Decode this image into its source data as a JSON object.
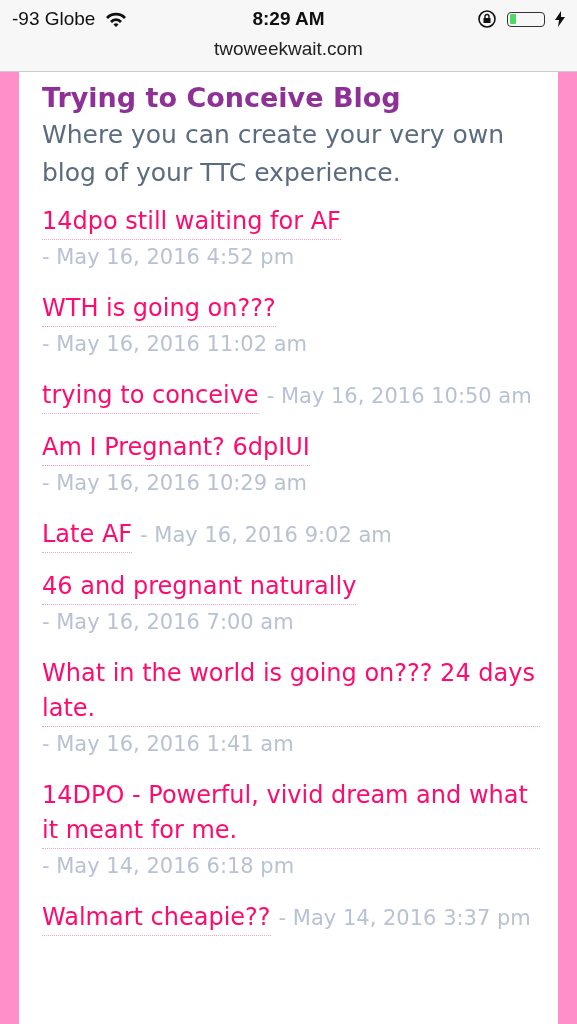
{
  "status_bar": {
    "carrier": "-93 Globe",
    "time": "8:29 AM",
    "charging": true
  },
  "address_bar": {
    "url": "twoweekwait.com"
  },
  "blog": {
    "title": "Trying to Conceive Blog",
    "subtitle": "Where you can create your very own blog of your TTC experience.",
    "posts": [
      {
        "title": "14dpo still waiting for AF",
        "date": "- May 16, 2016 4:52 pm"
      },
      {
        "title": "WTH is going on???",
        "date": "- May 16, 2016 11:02 am"
      },
      {
        "title": "trying to conceive",
        "date": "- May 16, 2016 10:50 am"
      },
      {
        "title": "Am I Pregnant? 6dpIUI",
        "date": "- May 16, 2016 10:29 am"
      },
      {
        "title": "Late AF",
        "date": "- May 16, 2016 9:02 am"
      },
      {
        "title": "46 and pregnant naturally",
        "date": "- May 16, 2016 7:00 am"
      },
      {
        "title": "What in the world is going on??? 24 days late.",
        "date": "- May 16, 2016 1:41 am"
      },
      {
        "title": "14DPO - Powerful, vivid dream and what it meant for me.",
        "date": "- May 14, 2016 6:18 pm"
      },
      {
        "title": "Walmart cheapie??",
        "date": "- May 14, 2016 3:37 pm"
      }
    ]
  }
}
